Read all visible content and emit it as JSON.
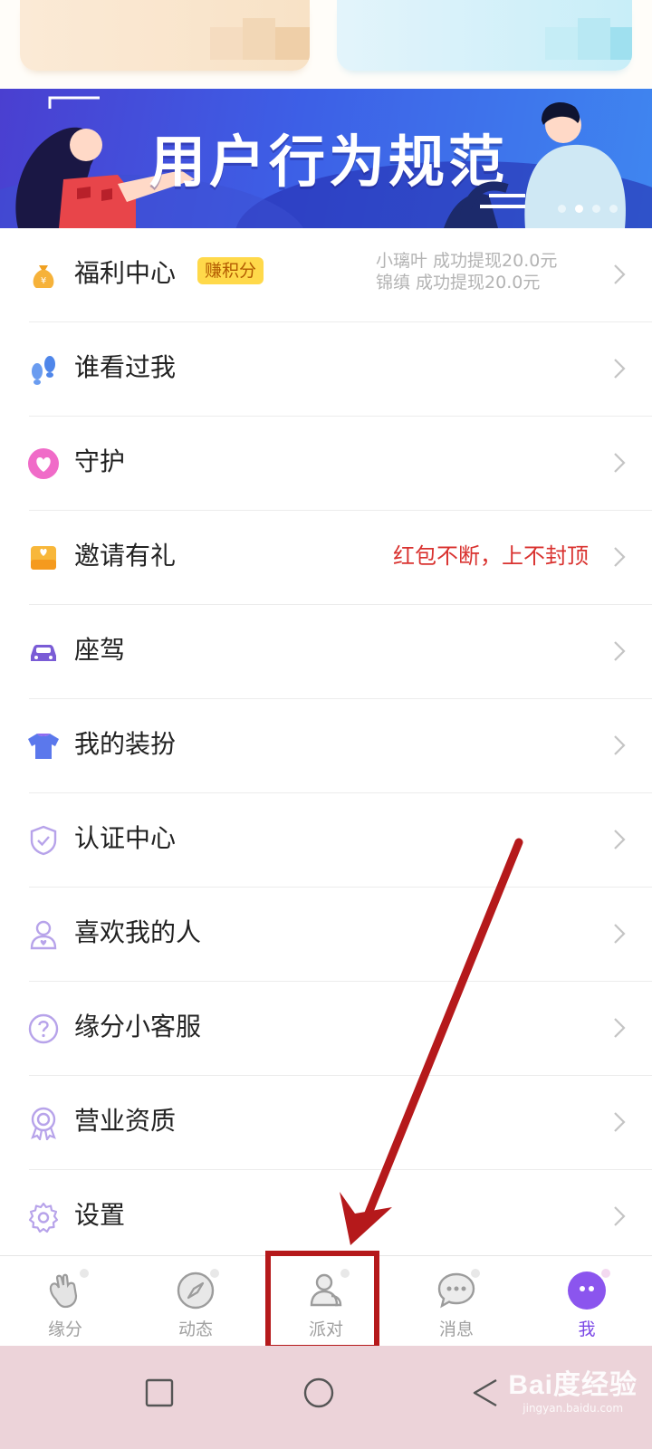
{
  "banner": {
    "title": "用户行为规范",
    "dot_count": 4,
    "active_dot": 2
  },
  "menu": {
    "items": [
      {
        "label": "福利中心",
        "icon": "money-bag-icon",
        "tag": "赚积分",
        "ticker": [
          "小璃叶 成功提现20.0元",
          "锦缜 成功提现20.0元"
        ]
      },
      {
        "label": "谁看过我",
        "icon": "footprints-icon"
      },
      {
        "label": "守护",
        "icon": "heart-shield-icon"
      },
      {
        "label": "邀请有礼",
        "icon": "gift-envelope-icon",
        "side_text": "红包不断，上不封顶"
      },
      {
        "label": "座驾",
        "icon": "car-icon"
      },
      {
        "label": "我的装扮",
        "icon": "tshirt-icon"
      },
      {
        "label": "认证中心",
        "icon": "verified-shield-icon"
      },
      {
        "label": "喜欢我的人",
        "icon": "person-heart-icon"
      },
      {
        "label": "缘分小客服",
        "icon": "help-question-icon"
      },
      {
        "label": "营业资质",
        "icon": "certificate-badge-icon"
      },
      {
        "label": "设置",
        "icon": "gear-icon"
      }
    ]
  },
  "nav": {
    "items": [
      {
        "label": "缘分",
        "icon": "hand-heart-icon",
        "active": false
      },
      {
        "label": "动态",
        "icon": "compass-icon",
        "active": false
      },
      {
        "label": "派对",
        "icon": "people-icon",
        "active": false
      },
      {
        "label": "消息",
        "icon": "chat-bubble-icon",
        "active": false
      },
      {
        "label": "我",
        "icon": "profile-face-icon",
        "active": true
      }
    ]
  },
  "system_bar": {
    "buttons": [
      "recents-square-icon",
      "home-circle-icon",
      "back-triangle-icon"
    ]
  },
  "watermark": {
    "brand": "Bai度经验",
    "url": "jingyan.baidu.com"
  },
  "colors": {
    "accent": "#7b48e6",
    "highlight": "#b5191b",
    "red_text": "#d9322f",
    "tag_bg": "#ffd94a"
  }
}
